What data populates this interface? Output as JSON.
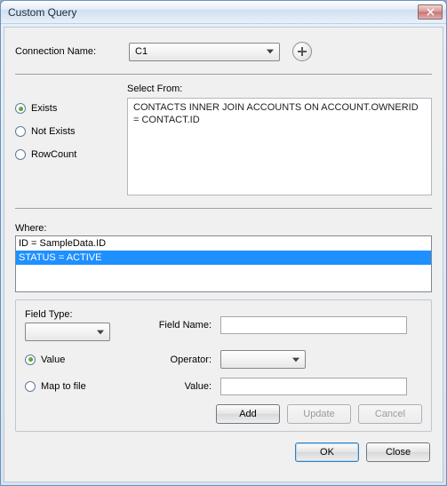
{
  "window": {
    "title": "Custom Query"
  },
  "connection": {
    "label": "Connection Name:",
    "value": "C1"
  },
  "select_from": {
    "label": "Select From:",
    "text": "CONTACTS INNER JOIN ACCOUNTS ON ACCOUNT.OWNERID = CONTACT.ID"
  },
  "exist_radios": {
    "exists": "Exists",
    "not_exists": "Not Exists",
    "rowcount": "RowCount",
    "selected": "exists"
  },
  "where": {
    "label": "Where:",
    "rows": [
      {
        "text": "ID = SampleData.ID",
        "selected": false
      },
      {
        "text": "STATUS = ACTIVE",
        "selected": true
      }
    ]
  },
  "field": {
    "type_label": "Field Type:",
    "type_value": "",
    "name_label": "Field Name:",
    "name_value": "",
    "value_radio": "Value",
    "map_radio": "Map to file",
    "selected_radio": "value",
    "operator_label": "Operator:",
    "operator_value": "",
    "value_label": "Value:",
    "value_value": ""
  },
  "buttons": {
    "add": "Add",
    "update": "Update",
    "cancel": "Cancel",
    "ok": "OK",
    "close": "Close"
  }
}
